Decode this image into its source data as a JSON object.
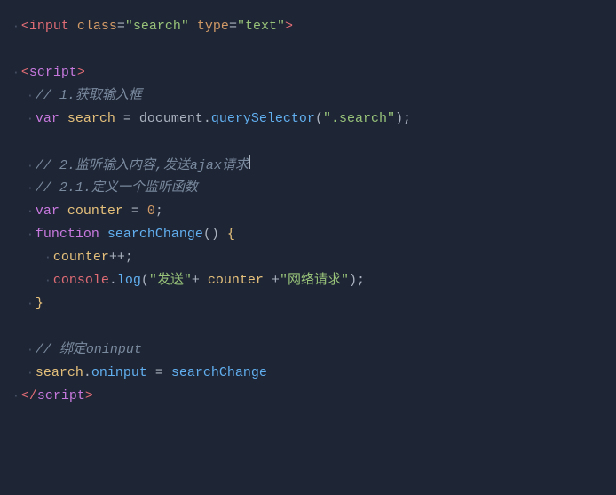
{
  "editor": {
    "background": "#1e2535",
    "lines": [
      {
        "id": "line1",
        "type": "html-tag"
      },
      {
        "id": "line2",
        "type": "empty"
      },
      {
        "id": "line3",
        "type": "script-open"
      },
      {
        "id": "line4",
        "type": "comment-1"
      },
      {
        "id": "line5",
        "type": "var-search"
      },
      {
        "id": "line6",
        "type": "empty"
      },
      {
        "id": "line7",
        "type": "comment-2"
      },
      {
        "id": "line8",
        "type": "comment-2-1"
      },
      {
        "id": "line9",
        "type": "var-counter"
      },
      {
        "id": "line10",
        "type": "func-def"
      },
      {
        "id": "line11",
        "type": "counter-inc"
      },
      {
        "id": "line12",
        "type": "console-log"
      },
      {
        "id": "line13",
        "type": "close-brace"
      },
      {
        "id": "line14",
        "type": "empty"
      },
      {
        "id": "line15",
        "type": "comment-3"
      },
      {
        "id": "line16",
        "type": "search-oninput"
      },
      {
        "id": "line17",
        "type": "script-close"
      }
    ]
  }
}
